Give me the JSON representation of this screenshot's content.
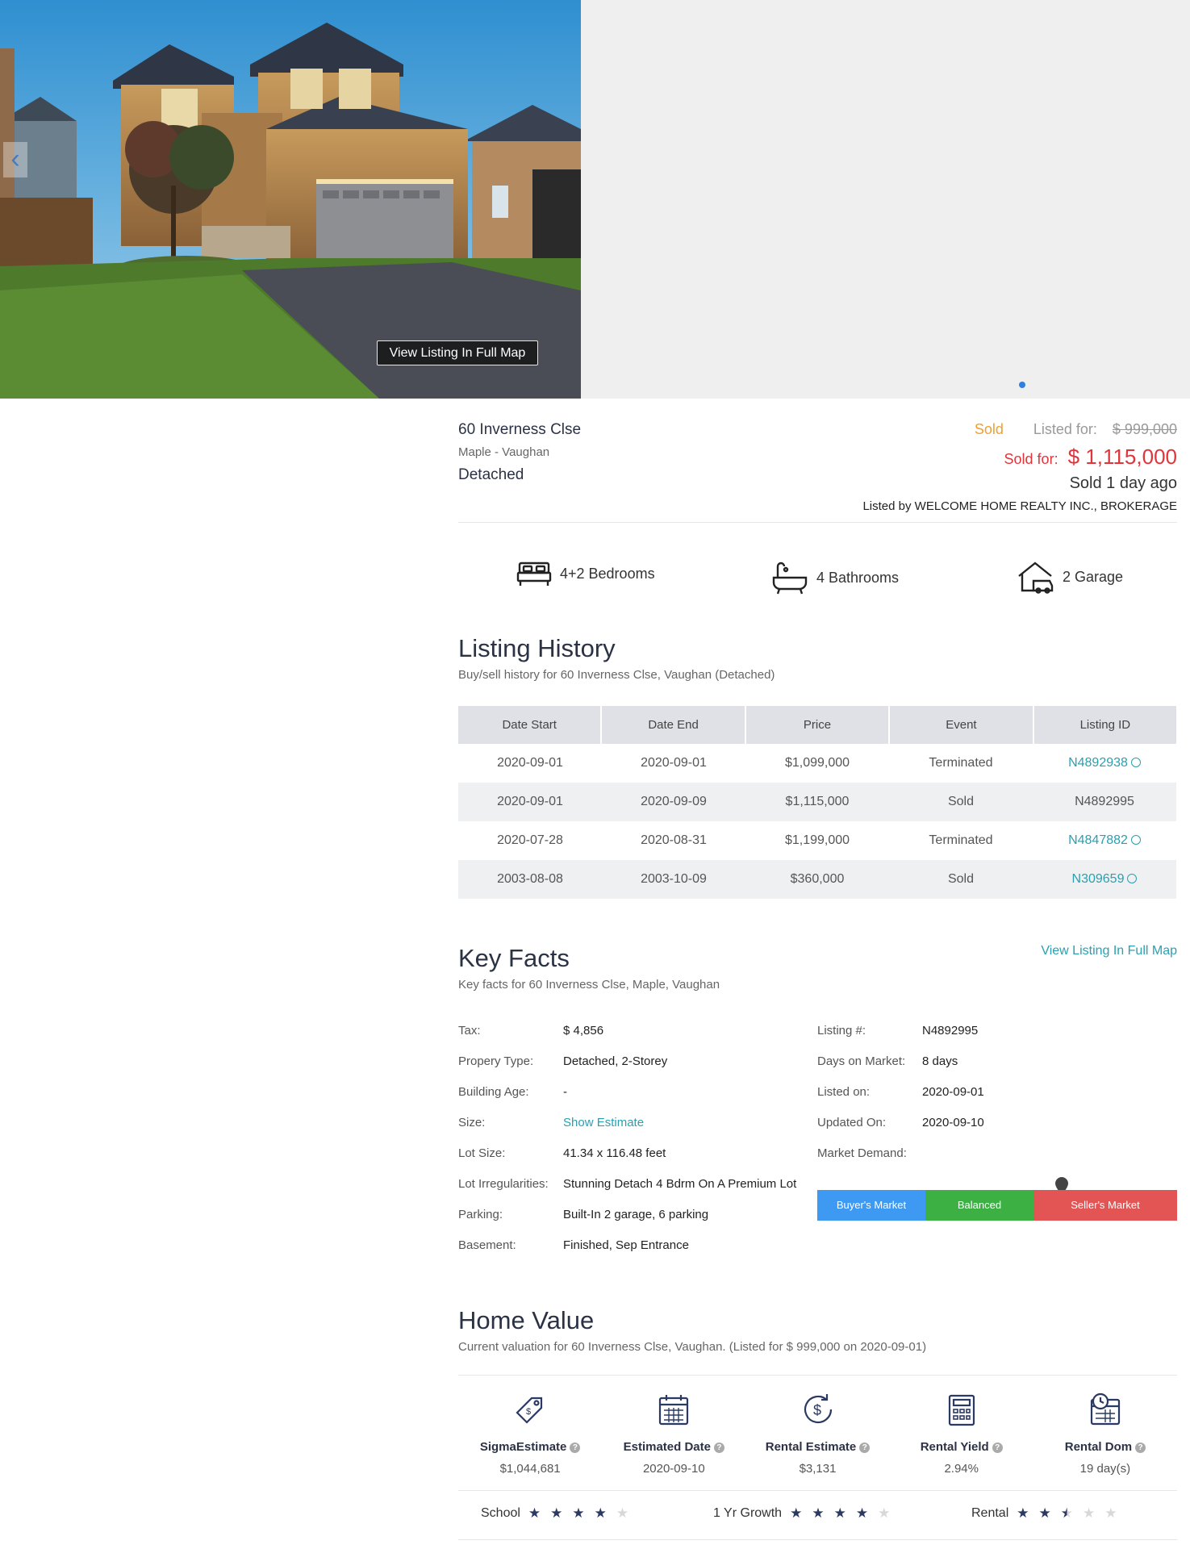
{
  "hero": {
    "full_map_button": "View Listing In Full Map"
  },
  "listing": {
    "address": "60 Inverness Clse",
    "area": "Maple - Vaughan",
    "type": "Detached",
    "status": "Sold",
    "listed_for_label": "Listed for:",
    "listed_price": "$ 999,000",
    "sold_for_label": "Sold for:",
    "sold_price": "$ 1,115,000",
    "sold_ago": "Sold 1 day ago",
    "listed_by": "Listed by WELCOME HOME REALTY INC., BROKERAGE"
  },
  "features": {
    "bedrooms": "4+2 Bedrooms",
    "bathrooms": "4 Bathrooms",
    "garage": "2 Garage"
  },
  "history": {
    "title": "Listing History",
    "subtitle": "Buy/sell history for 60 Inverness Clse, Vaughan (Detached)",
    "columns": [
      "Date Start",
      "Date End",
      "Price",
      "Event",
      "Listing ID"
    ],
    "rows": [
      {
        "start": "2020-09-01",
        "end": "2020-09-01",
        "price": "$1,099,000",
        "event": "Terminated",
        "id": "N4892938"
      },
      {
        "start": "2020-09-01",
        "end": "2020-09-09",
        "price": "$1,115,000",
        "event": "Sold",
        "id": "N4892995"
      },
      {
        "start": "2020-07-28",
        "end": "2020-08-31",
        "price": "$1,199,000",
        "event": "Terminated",
        "id": "N4847882"
      },
      {
        "start": "2003-08-08",
        "end": "2003-10-09",
        "price": "$360,000",
        "event": "Sold",
        "id": "N309659"
      }
    ]
  },
  "key_facts": {
    "title": "Key Facts",
    "subtitle": "Key facts for 60 Inverness Clse, Maple, Vaughan",
    "full_map_link": "View Listing In Full Map",
    "left": [
      {
        "k": "Tax:",
        "v": "$ 4,856"
      },
      {
        "k": "Propery Type:",
        "v": "Detached, 2-Storey"
      },
      {
        "k": "Building Age:",
        "v": "-"
      },
      {
        "k": "Size:",
        "v": "Show Estimate"
      },
      {
        "k": "Lot Size:",
        "v": "41.34 x 116.48 feet"
      },
      {
        "k": "Lot Irregularities:",
        "v": "Stunning Detach 4 Bdrm On A Premium Lot"
      },
      {
        "k": "Parking:",
        "v": "Built-In 2 garage, 6 parking"
      },
      {
        "k": "Basement:",
        "v": "Finished, Sep Entrance"
      }
    ],
    "right": [
      {
        "k": "Listing #:",
        "v": "N4892995"
      },
      {
        "k": "Days on Market:",
        "v": "8 days"
      },
      {
        "k": "Listed on:",
        "v": "2020-09-01"
      },
      {
        "k": "Updated On:",
        "v": "2020-09-10"
      },
      {
        "k": "Market Demand:",
        "v": ""
      }
    ],
    "market": {
      "buyers": "Buyer's Market",
      "balanced": "Balanced",
      "sellers": "Seller's Market",
      "colors": {
        "buyers": "#3d99f2",
        "balanced": "#3cb043",
        "sellers": "#e35454"
      },
      "demand_level": 0.68
    }
  },
  "home_value": {
    "title": "Home Value",
    "subtitle": "Current valuation for 60 Inverness Clse, Vaughan. (Listed for $ 999,000 on 2020-09-01)",
    "metrics": [
      {
        "label": "SigmaEstimate",
        "value": "$1,044,681",
        "icon": "price-tag-icon"
      },
      {
        "label": "Estimated Date",
        "value": "2020-09-10",
        "icon": "calendar-icon"
      },
      {
        "label": "Rental Estimate",
        "value": "$3,131",
        "icon": "dollar-cycle-icon"
      },
      {
        "label": "Rental Yield",
        "value": "2.94%",
        "icon": "calculator-icon"
      },
      {
        "label": "Rental Dom",
        "value": "19 day(s)",
        "icon": "clock-calendar-icon"
      }
    ],
    "ratings": [
      {
        "label": "School",
        "stars": 4
      },
      {
        "label": "1 Yr Growth",
        "stars": 4
      },
      {
        "label": "Rental",
        "stars": 2.5
      }
    ]
  }
}
